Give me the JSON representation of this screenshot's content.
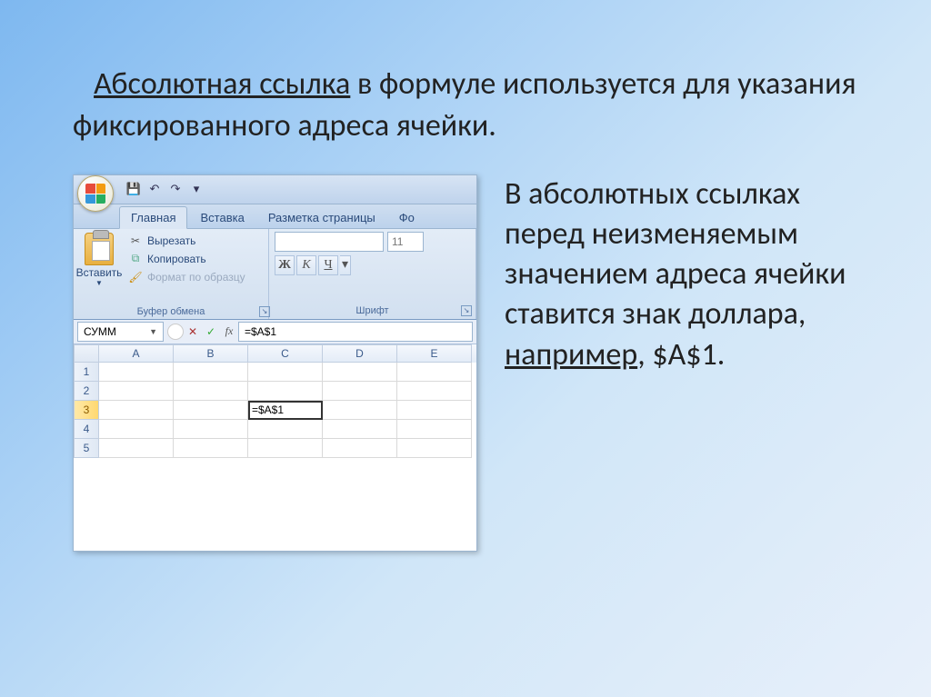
{
  "slide": {
    "top_text_underlined": "Абсолютная ссылка",
    "top_text_rest": " в формуле используется для указания фиксированного адреса ячейки.",
    "right_text_part1": "В абсолютных ссылках перед неизменяемым значением адреса ячейки ставится знак доллара, ",
    "right_text_underlined": "например",
    "right_text_part2": ", $A$1."
  },
  "excel": {
    "qat": {
      "save_icon": "💾",
      "undo_icon": "↶",
      "redo_icon": "↷",
      "dropdown_icon": "▾"
    },
    "tabs": {
      "home": "Главная",
      "insert": "Вставка",
      "page_layout": "Разметка страницы",
      "formulas_partial": "Фо"
    },
    "clipboard": {
      "paste_label": "Вставить",
      "cut": "Вырезать",
      "copy": "Копировать",
      "format_painter": "Формат по образцу",
      "group_label": "Буфер обмена"
    },
    "font": {
      "size_value": "11",
      "bold": "Ж",
      "italic": "К",
      "underline": "Ч",
      "group_label": "Шрифт"
    },
    "formula_bar": {
      "namebox": "СУММ",
      "cancel": "✕",
      "ok": "✓",
      "fx": "fx",
      "formula": "=$A$1"
    },
    "grid": {
      "columns": [
        "A",
        "B",
        "C",
        "D",
        "E"
      ],
      "rows": [
        "1",
        "2",
        "3",
        "4",
        "5"
      ],
      "active_cell_value": "=$A$1",
      "active_row": 3,
      "active_col": "C"
    }
  }
}
